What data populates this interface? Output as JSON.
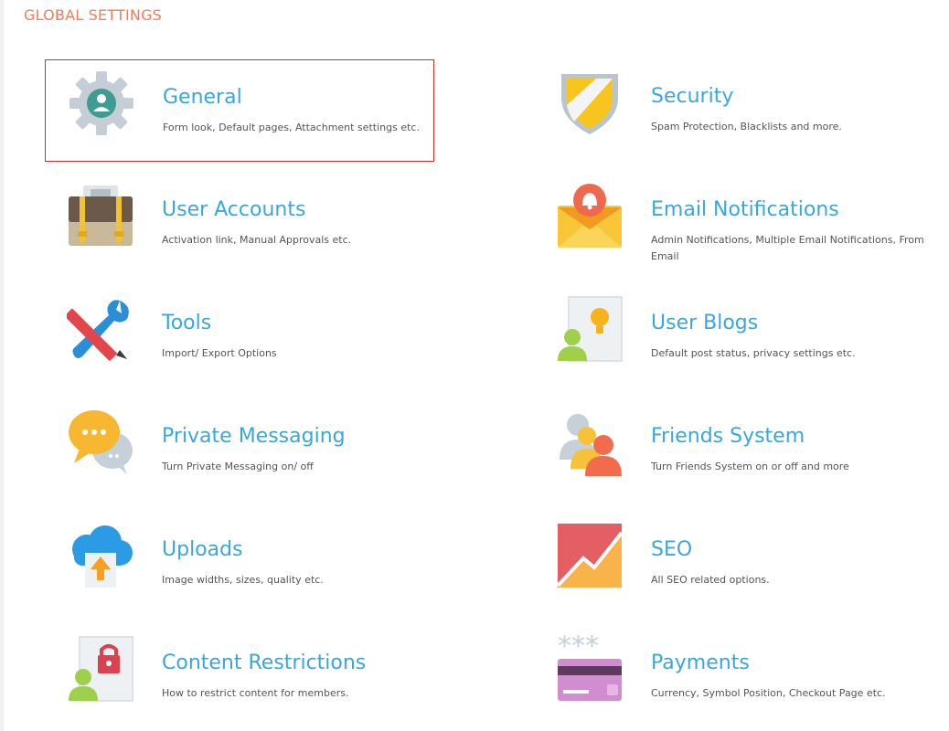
{
  "header": {
    "title": "GLOBAL SETTINGS"
  },
  "colors": {
    "accent_title": "#f07f59",
    "link_blue": "#3aa7dc",
    "selected_border": "#c9302c"
  },
  "tiles": [
    {
      "label": "General",
      "description": "Form look, Default pages, Attachment settings etc.",
      "icon": "gear-user-icon",
      "selected": true
    },
    {
      "label": "Security",
      "description": "Spam Protection, Blacklists and more.",
      "icon": "shield-icon",
      "selected": false
    },
    {
      "label": "User Accounts",
      "description": "Activation link, Manual Approvals etc.",
      "icon": "briefcase-icon",
      "selected": false
    },
    {
      "label": "Email Notifications",
      "description": "Admin Notifications, Multiple Email Notifications, From Email",
      "icon": "envelope-bell-icon",
      "selected": false
    },
    {
      "label": "Tools",
      "description": "Import/ Export Options",
      "icon": "pencil-wrench-icon",
      "selected": false
    },
    {
      "label": "User Blogs",
      "description": "Default post status, privacy settings etc.",
      "icon": "blog-idea-icon",
      "selected": false
    },
    {
      "label": "Private Messaging",
      "description": "Turn Private Messaging on/ off",
      "icon": "chat-bubbles-icon",
      "selected": false
    },
    {
      "label": "Friends System",
      "description": "Turn Friends System on or off and more",
      "icon": "friends-icon",
      "selected": false
    },
    {
      "label": "Uploads",
      "description": "Image widths, sizes, quality etc.",
      "icon": "cloud-upload-icon",
      "selected": false
    },
    {
      "label": "SEO",
      "description": "All SEO related options.",
      "icon": "seo-graph-icon",
      "selected": false
    },
    {
      "label": "Content Restrictions",
      "description": "How to restrict content for members.",
      "icon": "content-lock-icon",
      "selected": false
    },
    {
      "label": "Payments",
      "description": "Currency, Symbol Position, Checkout Page etc.",
      "icon": "credit-card-icon",
      "selected": false
    }
  ]
}
